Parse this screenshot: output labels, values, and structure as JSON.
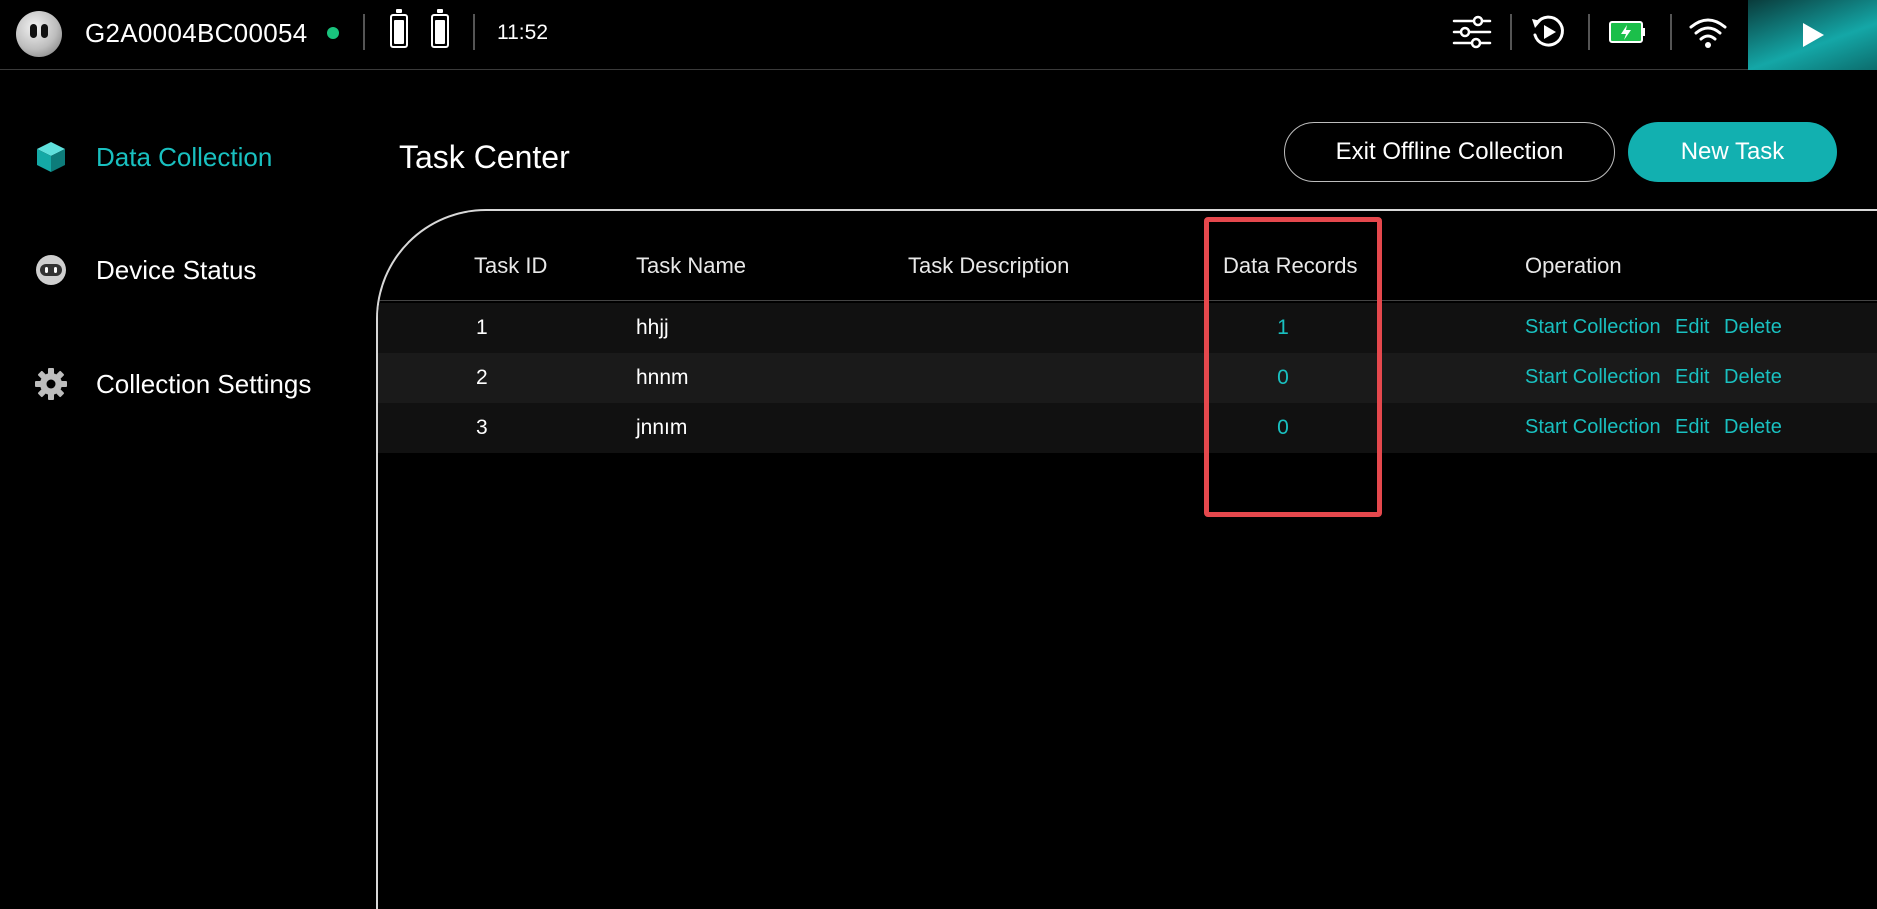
{
  "status_bar": {
    "device_id": "G2A0004BC00054",
    "time": "11:52",
    "icons": [
      "robot-avatar",
      "online-dot",
      "battery-icon",
      "battery-icon",
      "sliders-icon",
      "replay-icon",
      "charging-battery-icon",
      "wifi-icon",
      "play-icon"
    ],
    "online_color": "#19c37d"
  },
  "sidebar": {
    "items": [
      {
        "label": "Data Collection",
        "icon": "cube-icon",
        "active": true
      },
      {
        "label": "Device Status",
        "icon": "robot-head-icon",
        "active": false
      },
      {
        "label": "Collection Settings",
        "icon": "gear-icon",
        "active": false
      }
    ]
  },
  "main": {
    "title": "Task Center",
    "exit_button": "Exit Offline Collection",
    "new_task_button": "New Task"
  },
  "table": {
    "columns": [
      "Task ID",
      "Task Name",
      "Task Description",
      "Data Records",
      "Operation"
    ],
    "rows": [
      {
        "id": "1",
        "name": "hhjj",
        "description": "",
        "records": "1"
      },
      {
        "id": "2",
        "name": "hnnm",
        "description": "",
        "records": "0"
      },
      {
        "id": "3",
        "name": "jnnım",
        "description": "",
        "records": "0"
      }
    ],
    "operations": {
      "start": "Start Collection",
      "edit": "Edit",
      "delete": "Delete"
    }
  },
  "colors": {
    "accent": "#12b0b0",
    "accent_text": "#19c0c0",
    "highlight": "#e5484d",
    "background": "#000000"
  }
}
